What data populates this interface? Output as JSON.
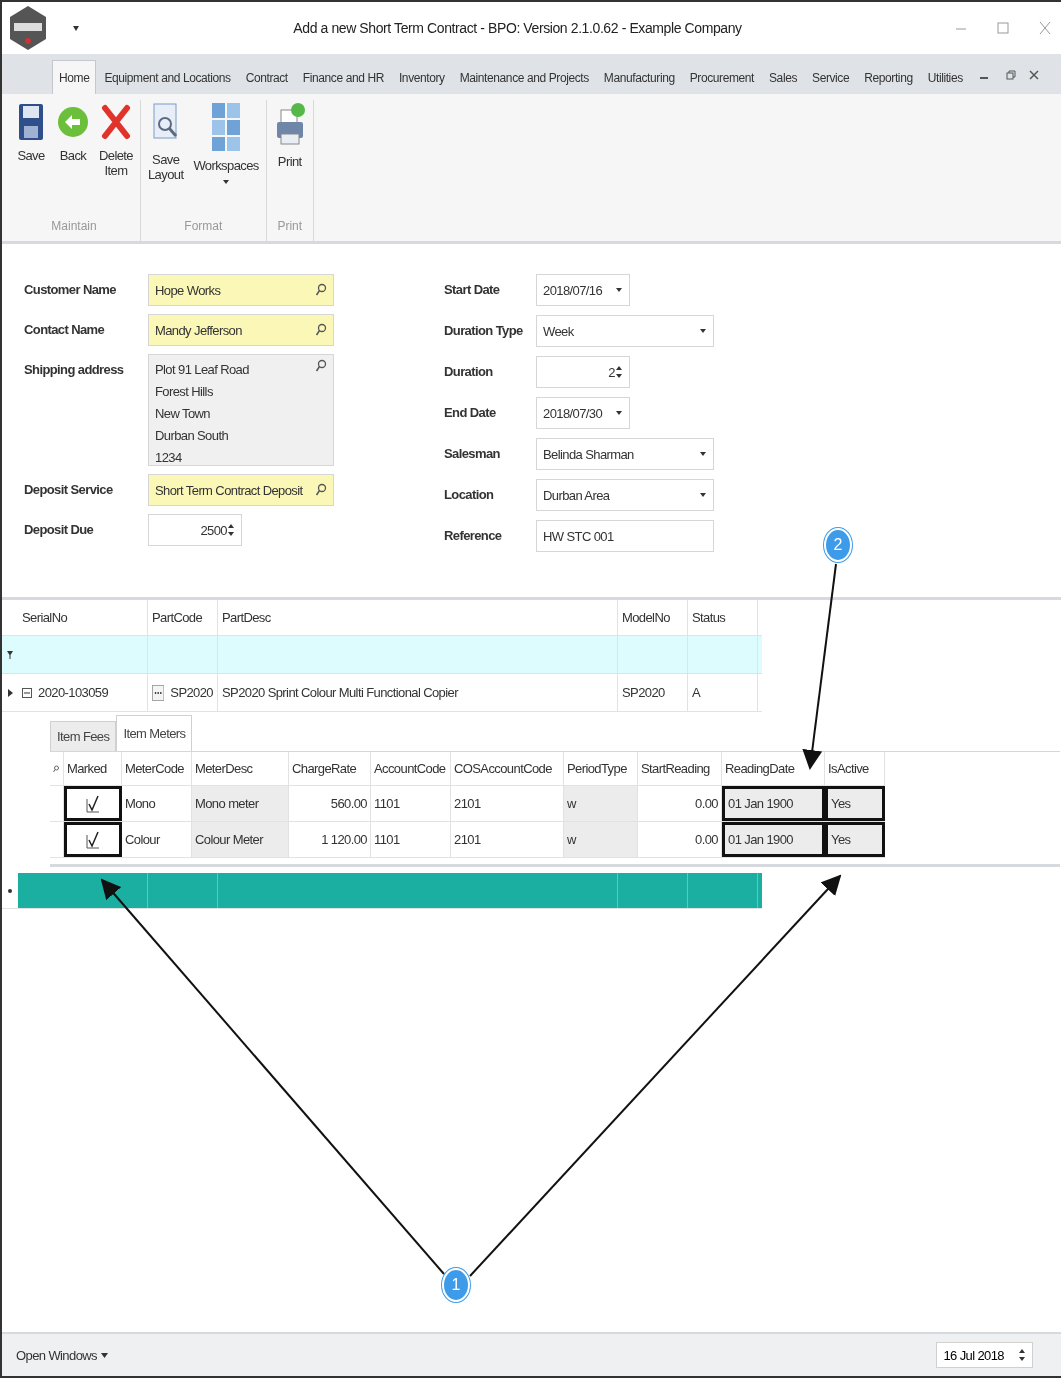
{
  "window": {
    "title": "Add a new Short Term Contract - BPO: Version 2.1.0.62 - Example Company"
  },
  "ribbon_tabs": [
    {
      "label": "Home",
      "selected": true
    },
    {
      "label": "Equipment and Locations",
      "selected": false
    },
    {
      "label": "Contract",
      "selected": false
    },
    {
      "label": "Finance and HR",
      "selected": false
    },
    {
      "label": "Inventory",
      "selected": false
    },
    {
      "label": "Maintenance and Projects",
      "selected": false
    },
    {
      "label": "Manufacturing",
      "selected": false
    },
    {
      "label": "Procurement",
      "selected": false
    },
    {
      "label": "Sales",
      "selected": false
    },
    {
      "label": "Service",
      "selected": false
    },
    {
      "label": "Reporting",
      "selected": false
    },
    {
      "label": "Utilities",
      "selected": false
    }
  ],
  "ribbon_groups": [
    {
      "label": "Maintain",
      "buttons": [
        {
          "label": "Save",
          "kind": "save"
        },
        {
          "label": "Back",
          "kind": "back"
        },
        {
          "label": "Delete Item",
          "kind": "delete"
        }
      ]
    },
    {
      "label": "Format",
      "buttons": [
        {
          "label": "Save Layout",
          "kind": "layout"
        },
        {
          "label": "Workspaces",
          "kind": "workspaces",
          "dropdown": true
        }
      ]
    },
    {
      "label": "Print",
      "buttons": [
        {
          "label": "Print",
          "kind": "print",
          "dropdown": false
        }
      ]
    }
  ],
  "form_left": [
    {
      "label": "Customer Name",
      "kind": "lookup",
      "value": "Hope Works"
    },
    {
      "label": "Contact Name",
      "kind": "lookup",
      "value": "Mandy Jefferson"
    },
    {
      "label": "Shipping address",
      "kind": "memo",
      "lines": [
        "Plot 91 Leaf Road",
        "Forest Hills",
        "New Town",
        "Durban South",
        "1234"
      ]
    },
    {
      "label": "Deposit Service",
      "kind": "lookup",
      "value": "Short Term Contract Deposit"
    },
    {
      "label": "Deposit Due",
      "kind": "spin",
      "value": "2500"
    }
  ],
  "form_right": [
    {
      "label": "Start Date",
      "kind": "date",
      "value": "2018/07/16"
    },
    {
      "label": "Duration Type",
      "kind": "dropdown",
      "value": "Week"
    },
    {
      "label": "Duration",
      "kind": "spin",
      "value": "2"
    },
    {
      "label": "End Date",
      "kind": "date",
      "value": "2018/07/30"
    },
    {
      "label": "Salesman",
      "kind": "dropdown",
      "value": "Belinda Sharman"
    },
    {
      "label": "Location",
      "kind": "dropdown",
      "value": "Durban Area"
    },
    {
      "label": "Reference",
      "kind": "text",
      "value": "HW STC 001"
    }
  ],
  "items_grid": {
    "columns": [
      "SerialNo",
      "PartCode",
      "PartDesc",
      "ModelNo",
      "Status"
    ],
    "rows": [
      {
        "expanded": true,
        "cells": [
          "2020-103059",
          "SP2020",
          "SP2020 Sprint Colour Multi Functional Copier",
          "SP2020",
          "A"
        ]
      }
    ]
  },
  "detail": {
    "tabs": [
      {
        "label": "Item Fees",
        "selected": false
      },
      {
        "label": "Item Meters",
        "selected": true
      }
    ],
    "columns": [
      {
        "label": "Marked",
        "highlighted": true
      },
      {
        "label": "MeterCode",
        "highlighted": false
      },
      {
        "label": "MeterDesc",
        "highlighted": false
      },
      {
        "label": "ChargeRate",
        "highlighted": false
      },
      {
        "label": "AccountCode",
        "highlighted": false
      },
      {
        "label": "COSAccountCode",
        "highlighted": false
      },
      {
        "label": "PeriodType",
        "highlighted": false
      },
      {
        "label": "StartReading",
        "highlighted": false
      },
      {
        "label": "ReadingDate",
        "highlighted": true
      },
      {
        "label": "IsActive",
        "highlighted": true
      }
    ],
    "rows": [
      {
        "marked": true,
        "cells": [
          "",
          "Mono",
          "Mono meter",
          "560.00",
          "1101",
          "2101",
          "w",
          "0.00",
          "01 Jan 1900",
          "Yes"
        ]
      },
      {
        "marked": true,
        "cells": [
          "",
          "Colour",
          "Colour Meter",
          "1 120.00",
          "1101",
          "2101",
          "w",
          "0.00",
          "01 Jan 1900",
          "Yes"
        ]
      }
    ]
  },
  "callouts": [
    "1",
    "2"
  ],
  "status_bar": {
    "open_windows": "Open Windows",
    "date": "16 Jul 2018"
  }
}
